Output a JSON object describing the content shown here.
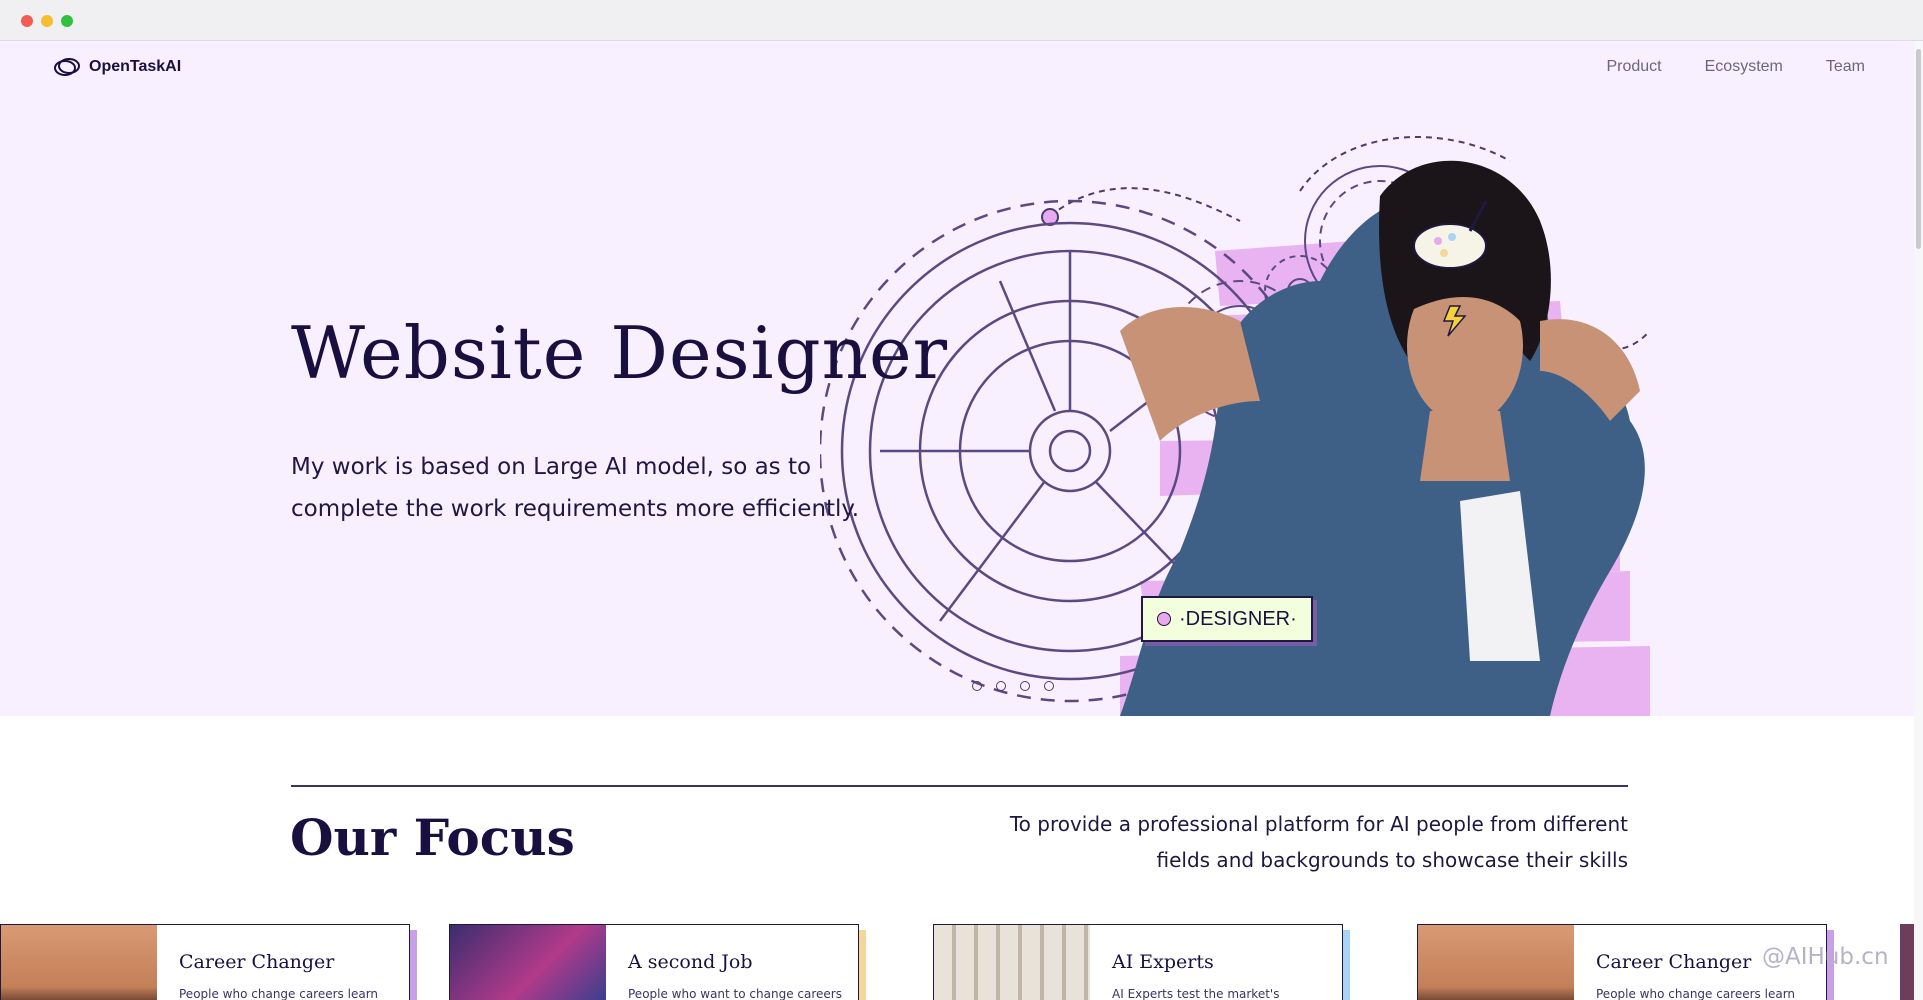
{
  "window": {
    "controls": [
      "close",
      "minimize",
      "zoom"
    ]
  },
  "nav": {
    "logo_text": "OpenTaskAI",
    "links": [
      "Product",
      "Ecosystem",
      "Team"
    ]
  },
  "hero": {
    "title": "Website Designer",
    "description": "My work is based on Large AI model, so as to complete the work requirements more efficiently.",
    "badge": "·DESIGNER·",
    "slide_count": 4
  },
  "focus": {
    "title": "Our Focus",
    "description": "To provide a professional platform for AI people from different fields and backgrounds to showcase their skills",
    "cards": [
      {
        "title": "Career Changer",
        "text": "People who change careers learn",
        "accent": "#c9a0e6"
      },
      {
        "title": "A second Job",
        "text": "People who want to change careers",
        "accent": "#f2d89a"
      },
      {
        "title": "AI Experts",
        "text": "AI Experts test the market's",
        "accent": "#a9d4f2"
      },
      {
        "title": "Career Changer",
        "text": "People who change careers learn",
        "accent": "#c9a0e6"
      }
    ]
  },
  "watermark": "@AIHub.cn",
  "colors": {
    "hero_background": "#f8f0fe",
    "text_primary": "#1a1040",
    "accent_purple": "#7a5ba6",
    "accent_pink": "#e8a9ef"
  }
}
